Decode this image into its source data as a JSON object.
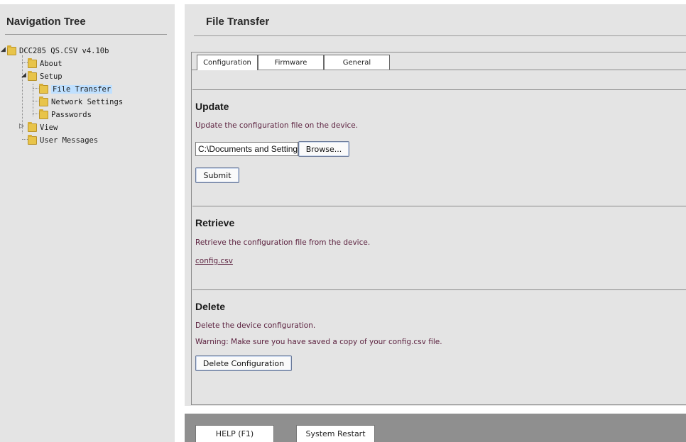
{
  "nav": {
    "title": "Navigation Tree",
    "tree": {
      "root": "DCC285 QS.CSV v4.10b",
      "about": "About",
      "setup": "Setup",
      "file_transfer": "File Transfer",
      "network_settings": "Network Settings",
      "passwords": "Passwords",
      "view": "View",
      "user_messages": "User Messages"
    }
  },
  "main": {
    "title": "File Transfer",
    "tabs": {
      "configuration": "Configuration",
      "firmware": "Firmware",
      "general": "General"
    },
    "active_tab": "Configuration",
    "update": {
      "title": "Update",
      "description": "Update the configuration file on the device.",
      "file_value": "C:\\Documents and Settings",
      "browse_label": "Browse...",
      "submit_label": "Submit"
    },
    "retrieve": {
      "title": "Retrieve",
      "description": "Retrieve the configuration file from the device.",
      "link_text": "config.csv"
    },
    "delete": {
      "title": "Delete",
      "description": "Delete the device configuration.",
      "warning": "Warning: Make sure you have saved a copy of your config.csv file.",
      "button_label": "Delete Configuration"
    }
  },
  "footer": {
    "help_label": "HELP (F1)",
    "restart_label": "System Restart"
  },
  "colors": {
    "panel_bg": "#e4e4e4",
    "text_accent": "#5a1f3d",
    "footer_bg": "#8f8f8f",
    "selected_bg": "#bfe0ff"
  }
}
